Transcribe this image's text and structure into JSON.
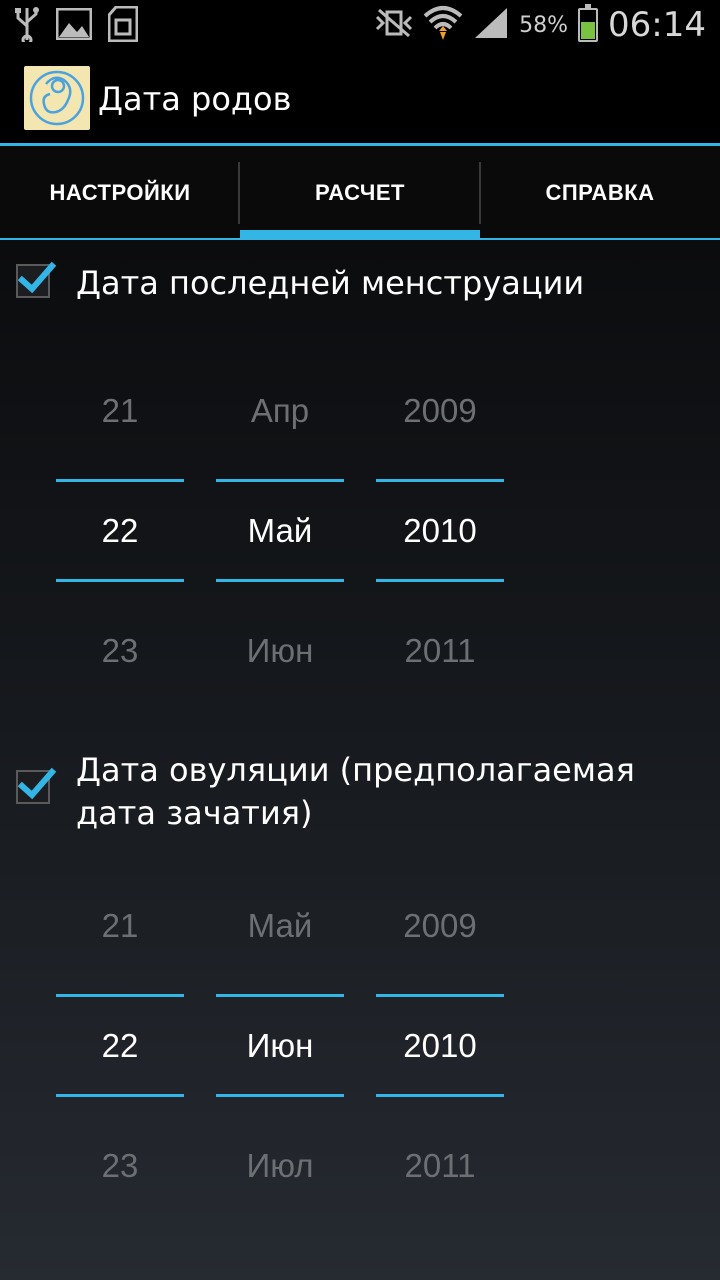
{
  "status_bar": {
    "icons_left": [
      "usb-icon",
      "gallery-icon",
      "sd-card-icon"
    ],
    "icons_right": [
      "vibrate-mute-icon",
      "wifi-icon",
      "signal-icon"
    ],
    "battery_percent": "58%",
    "battery_level": 0.58,
    "time": "06:14",
    "accent": "#33b5e5"
  },
  "action_bar": {
    "title": "Дата родов",
    "icon": "fetus-icon"
  },
  "tabs": [
    {
      "label": "НАСТРОЙКИ",
      "selected": false
    },
    {
      "label": "РАСЧЕТ",
      "selected": true
    },
    {
      "label": "СПРАВКА",
      "selected": false
    }
  ],
  "sections": [
    {
      "checked": true,
      "label": "Дата последней менструации",
      "picker": {
        "prev": {
          "day": "21",
          "month": "Апр",
          "year": "2009"
        },
        "selected": {
          "day": "22",
          "month": "Май",
          "year": "2010"
        },
        "next": {
          "day": "23",
          "month": "Июн",
          "year": "2011"
        }
      }
    },
    {
      "checked": true,
      "label": "Дата овуляции (предполагаемая дата зачатия)",
      "picker": {
        "prev": {
          "day": "21",
          "month": "Май",
          "year": "2009"
        },
        "selected": {
          "day": "22",
          "month": "Июн",
          "year": "2010"
        },
        "next": {
          "day": "23",
          "month": "Июл",
          "year": "2011"
        }
      }
    }
  ]
}
